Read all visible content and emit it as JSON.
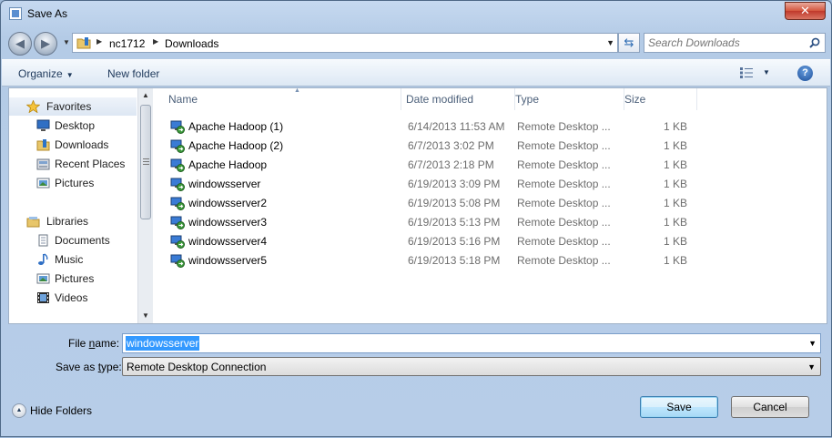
{
  "window": {
    "title": "Save As",
    "close_label": "✕"
  },
  "address_bar": {
    "breadcrumbs": [
      "nc1712",
      "Downloads"
    ],
    "search_placeholder": "Search Downloads"
  },
  "toolbar": {
    "organize_label": "Organize",
    "new_folder_label": "New folder",
    "help_label": "?"
  },
  "nav_pane": {
    "favorites_label": "Favorites",
    "favorites": [
      {
        "label": "Desktop",
        "icon": "desktop-icon"
      },
      {
        "label": "Downloads",
        "icon": "downloads-folder-icon"
      },
      {
        "label": "Recent Places",
        "icon": "recent-places-icon"
      },
      {
        "label": "Pictures",
        "icon": "pictures-icon"
      }
    ],
    "libraries_label": "Libraries",
    "libraries": [
      {
        "label": "Documents",
        "icon": "documents-icon"
      },
      {
        "label": "Music",
        "icon": "music-icon"
      },
      {
        "label": "Pictures",
        "icon": "pictures-icon"
      },
      {
        "label": "Videos",
        "icon": "videos-icon"
      }
    ]
  },
  "file_list": {
    "columns": [
      "Name",
      "Date modified",
      "Type",
      "Size"
    ],
    "rows": [
      {
        "name": "Apache Hadoop (1)",
        "date": "6/14/2013 11:53 AM",
        "type": "Remote Desktop ...",
        "size": "1 KB"
      },
      {
        "name": "Apache Hadoop (2)",
        "date": "6/7/2013 3:02 PM",
        "type": "Remote Desktop ...",
        "size": "1 KB"
      },
      {
        "name": "Apache Hadoop",
        "date": "6/7/2013 2:18 PM",
        "type": "Remote Desktop ...",
        "size": "1 KB"
      },
      {
        "name": "windowsserver",
        "date": "6/19/2013 3:09 PM",
        "type": "Remote Desktop ...",
        "size": "1 KB"
      },
      {
        "name": "windowsserver2",
        "date": "6/19/2013 5:08 PM",
        "type": "Remote Desktop ...",
        "size": "1 KB"
      },
      {
        "name": "windowsserver3",
        "date": "6/19/2013 5:13 PM",
        "type": "Remote Desktop ...",
        "size": "1 KB"
      },
      {
        "name": "windowsserver4",
        "date": "6/19/2013 5:16 PM",
        "type": "Remote Desktop ...",
        "size": "1 KB"
      },
      {
        "name": "windowsserver5",
        "date": "6/19/2013 5:18 PM",
        "type": "Remote Desktop ...",
        "size": "1 KB"
      }
    ]
  },
  "form": {
    "file_name_label_pre": "File ",
    "file_name_label_ul": "n",
    "file_name_label_post": "ame:",
    "file_name_value": "windowsserver",
    "save_type_label_pre": "Save as ",
    "save_type_label_ul": "t",
    "save_type_label_post": "ype:",
    "save_type_value": "Remote Desktop Connection"
  },
  "footer": {
    "hide_folders_label": "Hide Folders",
    "save_label": "Save",
    "cancel_label": "Cancel"
  },
  "colors": {
    "selection": "#3399ff",
    "frame": "#b7cde8"
  }
}
